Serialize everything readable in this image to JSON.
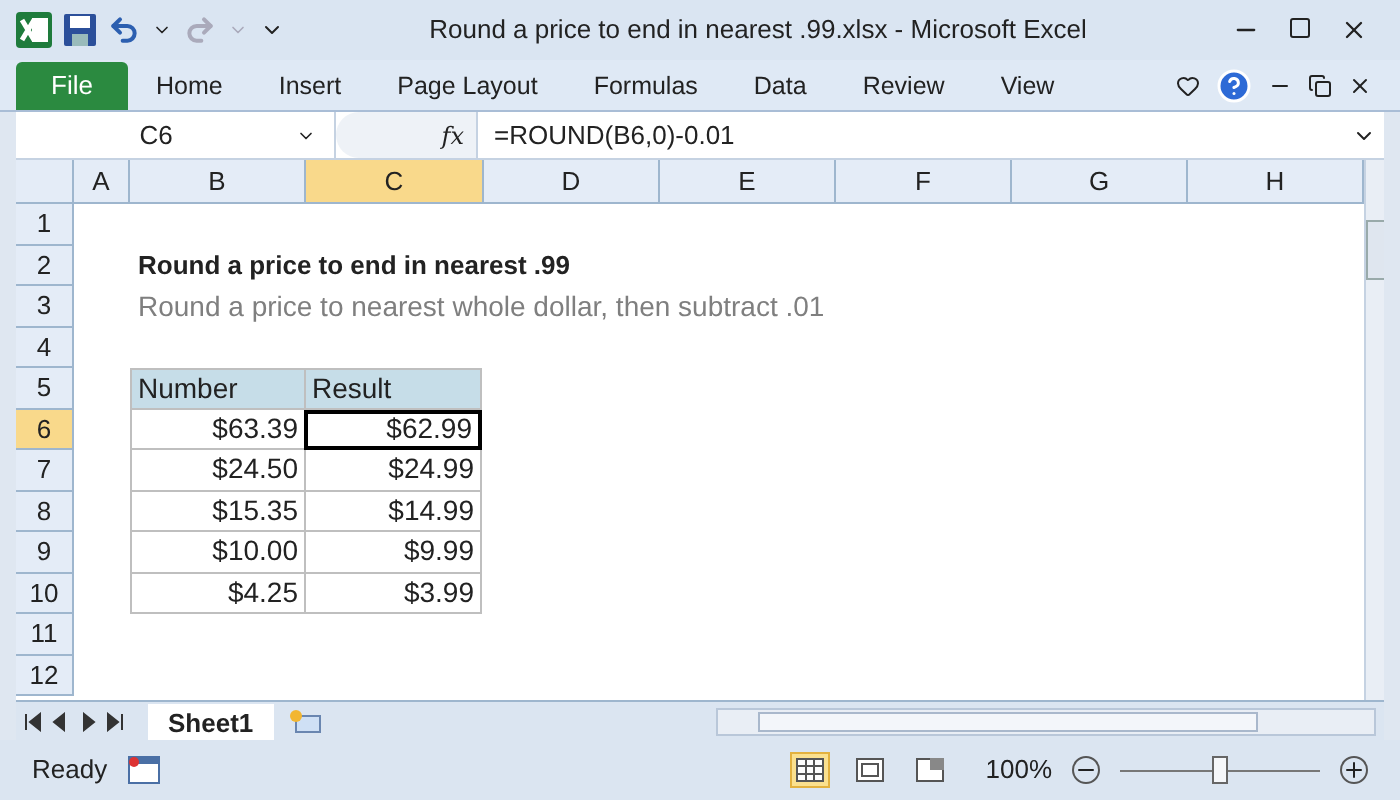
{
  "window": {
    "title": "Round a price to end in nearest .99.xlsx  -  Microsoft Excel"
  },
  "ribbon": {
    "tabs": [
      {
        "label": "File",
        "kind": "file",
        "selected": false
      },
      {
        "label": "Home",
        "kind": "tab",
        "selected": false
      },
      {
        "label": "Insert",
        "kind": "tab",
        "selected": false
      },
      {
        "label": "Page Layout",
        "kind": "tab",
        "selected": false
      },
      {
        "label": "Formulas",
        "kind": "tab",
        "selected": false
      },
      {
        "label": "Data",
        "kind": "tab",
        "selected": false
      },
      {
        "label": "Review",
        "kind": "tab",
        "selected": false
      },
      {
        "label": "View",
        "kind": "tab",
        "selected": false
      }
    ]
  },
  "formula_bar": {
    "name_box": "C6",
    "function_label": "fx",
    "formula": "=ROUND(B6,0)-0.01"
  },
  "columns": [
    {
      "label": "A",
      "selected": false
    },
    {
      "label": "B",
      "selected": false
    },
    {
      "label": "C",
      "selected": true
    },
    {
      "label": "D",
      "selected": false
    },
    {
      "label": "E",
      "selected": false
    },
    {
      "label": "F",
      "selected": false
    },
    {
      "label": "G",
      "selected": false
    },
    {
      "label": "H",
      "selected": false
    }
  ],
  "rows": [
    {
      "label": "1",
      "selected": false
    },
    {
      "label": "2",
      "selected": false
    },
    {
      "label": "3",
      "selected": false
    },
    {
      "label": "4",
      "selected": false
    },
    {
      "label": "5",
      "selected": false
    },
    {
      "label": "6",
      "selected": true
    },
    {
      "label": "7",
      "selected": false
    },
    {
      "label": "8",
      "selected": false
    },
    {
      "label": "9",
      "selected": false
    },
    {
      "label": "10",
      "selected": false
    },
    {
      "label": "11",
      "selected": false
    },
    {
      "label": "12",
      "selected": false
    }
  ],
  "heading": "Round a price to end in nearest .99",
  "subheading": "Round a price to nearest whole dollar, then subtract .01",
  "table": {
    "columns": [
      "Number",
      "Result"
    ],
    "rows": [
      {
        "number": "$63.39",
        "result": "$62.99",
        "result_selected": true
      },
      {
        "number": "$24.50",
        "result": "$24.99",
        "result_selected": false
      },
      {
        "number": "$15.35",
        "result": "$14.99",
        "result_selected": false
      },
      {
        "number": "$10.00",
        "result": "$9.99",
        "result_selected": false
      },
      {
        "number": "$4.25",
        "result": "$3.99",
        "result_selected": false
      }
    ]
  },
  "sheet_tabs": [
    {
      "label": "Sheet1",
      "selected": true
    }
  ],
  "status_bar": {
    "status": "Ready",
    "views": [
      {
        "kind": "normal",
        "selected": true
      },
      {
        "kind": "page_layout",
        "selected": false
      },
      {
        "kind": "page_break",
        "selected": false
      }
    ],
    "zoom": "100%",
    "zoom_slider": {
      "level": 0.5
    }
  }
}
